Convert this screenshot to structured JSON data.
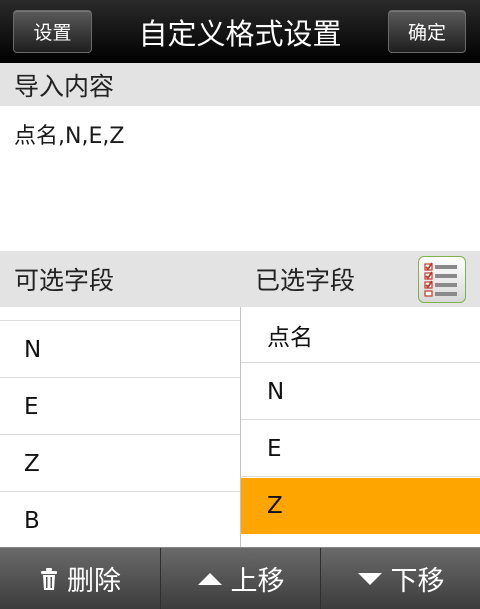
{
  "topbar": {
    "left_button": "设置",
    "title": "自定义格式设置",
    "right_button": "确定"
  },
  "import": {
    "header": "导入内容",
    "content": "点名,N,E,Z"
  },
  "fields": {
    "available_label": "可选字段",
    "selected_label": "已选字段",
    "available": [
      "N",
      "E",
      "Z",
      "B"
    ],
    "selected": [
      "点名",
      "N",
      "E",
      "Z"
    ],
    "selected_highlight_index": 3,
    "highlight_color": "#FFA500"
  },
  "bottombar": {
    "delete_label": "删除",
    "up_label": "上移",
    "down_label": "下移"
  },
  "icons": {
    "delete": "trash-icon",
    "up": "triangle-up-icon",
    "down": "triangle-down-icon",
    "list": "checklist-icon"
  }
}
